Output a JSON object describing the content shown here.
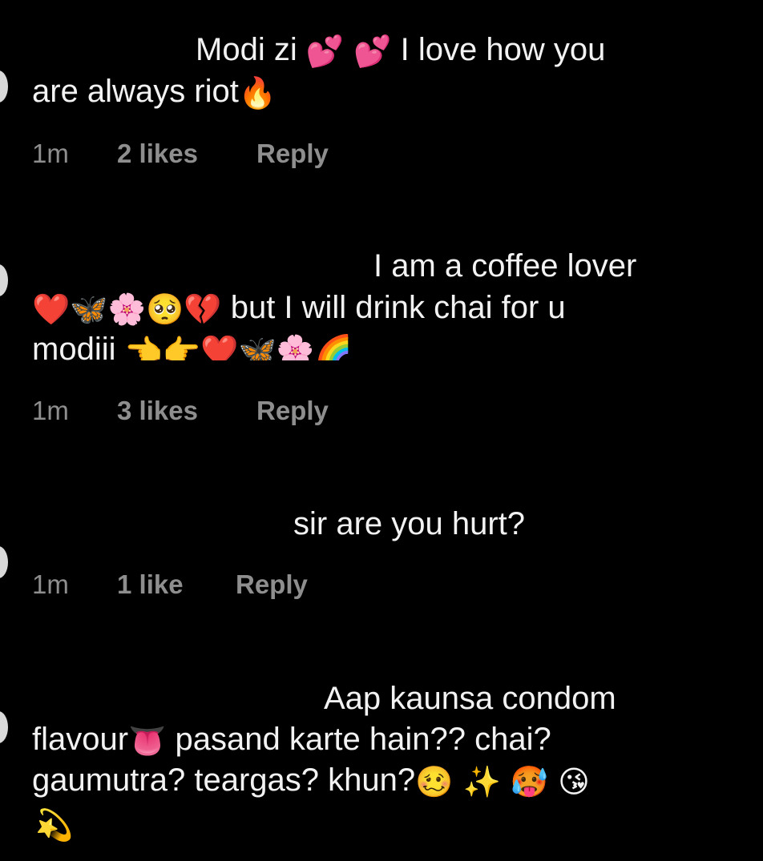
{
  "comments": [
    {
      "lines": [
        {
          "text": "Modi zi",
          "emoji": "💕 💕",
          "after": "I love how you"
        },
        {
          "text": "are always riot",
          "emoji": "🔥",
          "after": ""
        }
      ],
      "time": "1m",
      "likes": "2 likes",
      "reply": "Reply"
    },
    {
      "lines": [
        {
          "text": "I am a coffee lover",
          "emoji": "",
          "after": ""
        },
        {
          "text": "",
          "emoji": "❤️🦋🌸🥺💔",
          "after": "but I will drink chai for u"
        },
        {
          "text": "modiii",
          "emoji": "👈👉❤️🦋🌸🌈",
          "after": ""
        }
      ],
      "time": "1m",
      "likes": "3 likes",
      "reply": "Reply"
    },
    {
      "lines": [
        {
          "text": "sir are you hurt?",
          "emoji": "",
          "after": ""
        }
      ],
      "time": "1m",
      "likes": "1 like",
      "reply": "Reply"
    },
    {
      "lines": [
        {
          "text": "Aap kaunsa condom",
          "emoji": "",
          "after": ""
        },
        {
          "text": "flavour",
          "emoji": "👅",
          "after": "pasand karte hain?? chai?"
        },
        {
          "text": "gaumutra? teargas? khun?",
          "emoji": "🥴 ✨ 🥵 😘",
          "after": ""
        },
        {
          "text": "",
          "emoji": "💫",
          "after": ""
        }
      ],
      "time": "",
      "likes": "",
      "reply": ""
    }
  ],
  "icons": {
    "avatar": "avatar-partial"
  }
}
